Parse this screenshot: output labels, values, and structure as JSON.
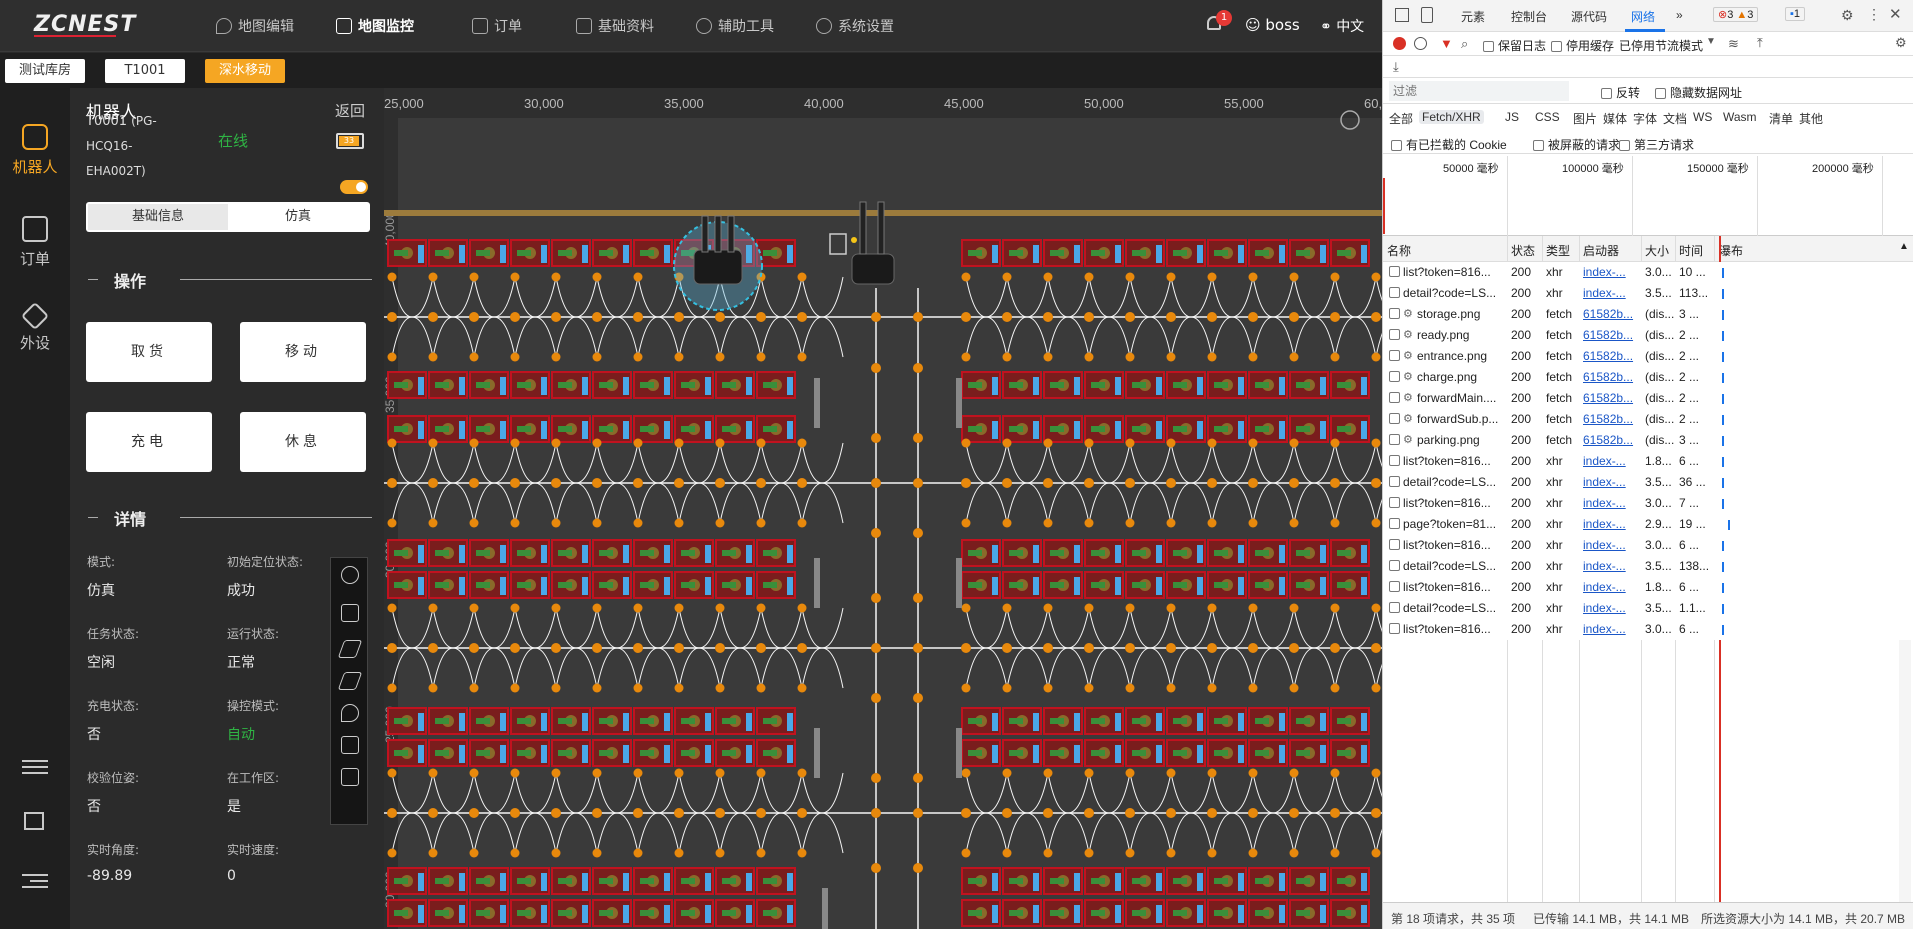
{
  "app": {
    "logo": "ZCNEST",
    "nav": [
      {
        "label": "地图编辑",
        "icon": "location-icon"
      },
      {
        "label": "地图监控",
        "icon": "chart-icon",
        "active": true
      },
      {
        "label": "订单",
        "icon": "document-icon"
      },
      {
        "label": "基础资料",
        "icon": "sliders-icon"
      },
      {
        "label": "辅助工具",
        "icon": "gear-icon"
      },
      {
        "label": "系统设置",
        "icon": "gear-icon"
      }
    ],
    "notification_count": "1",
    "user": "boss",
    "language": "中文"
  },
  "subbar": {
    "warehouse": "测试库房",
    "code": "T1001",
    "action": "深水移动"
  },
  "sidenav": {
    "items": [
      {
        "label": "机器人",
        "icon": "robot-icon",
        "active": true
      },
      {
        "label": "订单",
        "icon": "document-icon"
      },
      {
        "label": "外设",
        "icon": "wrench-icon"
      }
    ]
  },
  "panel": {
    "title": "机器人",
    "back": "返回",
    "robot_name_line1": "T0001",
    "robot_name_suffix": "(PG-",
    "robot_name_line2": "HCQ16-",
    "robot_name_line3": "EHA002T)",
    "status": "在线",
    "battery": "33",
    "tabs": [
      "基础信息",
      "仿真"
    ],
    "operations_title": "操作",
    "operations": [
      "取货",
      "移动",
      "充电",
      "休息"
    ],
    "details_title": "详情",
    "details": [
      {
        "label": "模式:",
        "value": "仿真"
      },
      {
        "label": "初始定位状态:",
        "value": "成功"
      },
      {
        "label": "任务状态:",
        "value": "空闲"
      },
      {
        "label": "运行状态:",
        "value": "正常"
      },
      {
        "label": "充电状态:",
        "value": "否"
      },
      {
        "label": "操控模式:",
        "value": "自动"
      },
      {
        "label": "校验位姿:",
        "value": "否"
      },
      {
        "label": "在工作区:",
        "value": "是"
      },
      {
        "label": "实时角度:",
        "value": "-89.89"
      },
      {
        "label": "实时速度:",
        "value": "0"
      }
    ]
  },
  "map": {
    "x_ticks": [
      "25,000",
      "30,000",
      "35,000",
      "40,000",
      "45,000",
      "50,000",
      "55,000",
      "60,0"
    ],
    "y_ticks": [
      "40,000",
      "35,000",
      "30,000",
      "25,000",
      "20,000"
    ],
    "colors": {
      "route": "#f5f5f5",
      "node": "#e8890c",
      "rack": "#c1121f",
      "cell": "#4aa8e8"
    }
  },
  "devtools": {
    "tabs": [
      "元素",
      "控制台",
      "源代码",
      "网络"
    ],
    "active_tab": "网络",
    "errors": "3",
    "warnings": "3",
    "messages": "1",
    "toolbar": {
      "preserve_log": "保留日志",
      "disable_cache": "停用缓存",
      "throttle": "已停用节流模式"
    },
    "filter_placeholder": "过滤",
    "invert": "反转",
    "hide_data_urls": "隐藏数据网址",
    "filter_types": [
      "全部",
      "Fetch/XHR",
      "JS",
      "CSS",
      "图片",
      "媒体",
      "字体",
      "文档",
      "WS",
      "Wasm",
      "清单",
      "其他"
    ],
    "blocked_cookies": "有已拦截的 Cookie",
    "blocked_requests": "被屏蔽的请求",
    "third_party": "第三方请求",
    "timeline_ticks": [
      "50000 毫秒",
      "100000 毫秒",
      "150000 毫秒",
      "200000 毫秒"
    ],
    "columns": [
      "名称",
      "状态",
      "类型",
      "启动器",
      "大小",
      "时间",
      "瀑布"
    ],
    "requests": [
      {
        "name": "list?token=816...",
        "status": "200",
        "type": "xhr",
        "initiator": "index-...",
        "size": "3.0...",
        "time": "10 ..."
      },
      {
        "name": "detail?code=LS...",
        "status": "200",
        "type": "xhr",
        "initiator": "index-...",
        "size": "3.5...",
        "time": "113..."
      },
      {
        "name": "storage.png",
        "status": "200",
        "type": "fetch",
        "initiator": "61582b...",
        "size": "(dis...",
        "time": "3 ..."
      },
      {
        "name": "ready.png",
        "status": "200",
        "type": "fetch",
        "initiator": "61582b...",
        "size": "(dis...",
        "time": "2 ..."
      },
      {
        "name": "entrance.png",
        "status": "200",
        "type": "fetch",
        "initiator": "61582b...",
        "size": "(dis...",
        "time": "2 ..."
      },
      {
        "name": "charge.png",
        "status": "200",
        "type": "fetch",
        "initiator": "61582b...",
        "size": "(dis...",
        "time": "2 ..."
      },
      {
        "name": "forwardMain....",
        "status": "200",
        "type": "fetch",
        "initiator": "61582b...",
        "size": "(dis...",
        "time": "2 ..."
      },
      {
        "name": "forwardSub.p...",
        "status": "200",
        "type": "fetch",
        "initiator": "61582b...",
        "size": "(dis...",
        "time": "2 ..."
      },
      {
        "name": "parking.png",
        "status": "200",
        "type": "fetch",
        "initiator": "61582b...",
        "size": "(dis...",
        "time": "3 ..."
      },
      {
        "name": "list?token=816...",
        "status": "200",
        "type": "xhr",
        "initiator": "index-...",
        "size": "1.8...",
        "time": "6 ..."
      },
      {
        "name": "detail?code=LS...",
        "status": "200",
        "type": "xhr",
        "initiator": "index-...",
        "size": "3.5...",
        "time": "36 ..."
      },
      {
        "name": "list?token=816...",
        "status": "200",
        "type": "xhr",
        "initiator": "index-...",
        "size": "3.0...",
        "time": "7 ..."
      },
      {
        "name": "page?token=81...",
        "status": "200",
        "type": "xhr",
        "initiator": "index-...",
        "size": "2.9...",
        "time": "19 ..."
      },
      {
        "name": "list?token=816...",
        "status": "200",
        "type": "xhr",
        "initiator": "index-...",
        "size": "3.0...",
        "time": "6 ..."
      },
      {
        "name": "detail?code=LS...",
        "status": "200",
        "type": "xhr",
        "initiator": "index-...",
        "size": "3.5...",
        "time": "138..."
      },
      {
        "name": "list?token=816...",
        "status": "200",
        "type": "xhr",
        "initiator": "index-...",
        "size": "1.8...",
        "time": "6 ..."
      },
      {
        "name": "detail?code=LS...",
        "status": "200",
        "type": "xhr",
        "initiator": "index-...",
        "size": "3.5...",
        "time": "1.1..."
      },
      {
        "name": "list?token=816...",
        "status": "200",
        "type": "xhr",
        "initiator": "index-...",
        "size": "3.0...",
        "time": "6 ..."
      }
    ],
    "status_requests": "第 18 项请求，共 35 项",
    "status_transferred": "已传输 14.1 MB，共 14.1 MB",
    "status_resources": "所选资源大小为 14.1 MB，共 20.7 MB"
  }
}
